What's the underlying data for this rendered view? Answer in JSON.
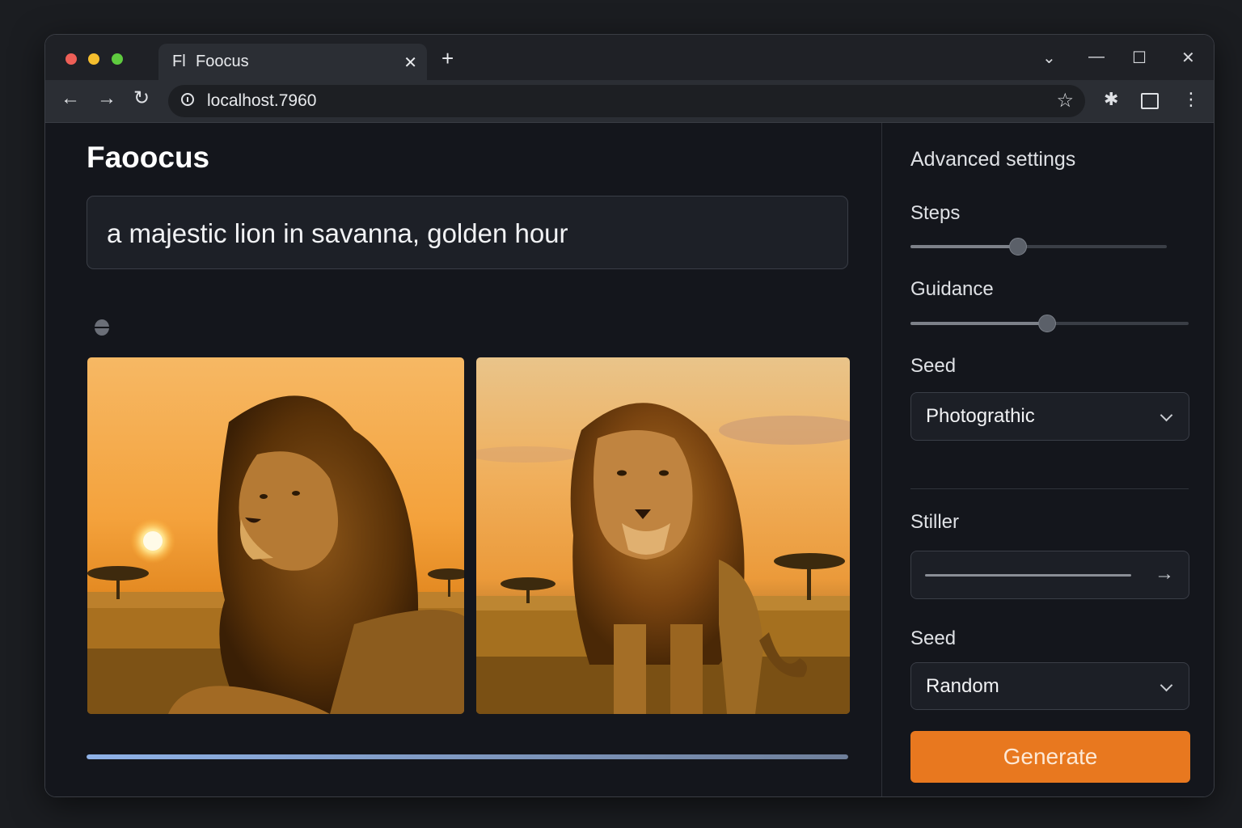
{
  "browser": {
    "tab": {
      "favicon_text": "Fl",
      "title": "Foocus",
      "close_glyph": "✕"
    },
    "new_tab_glyph": "+",
    "window_controls": [
      "⌄",
      "—",
      "☐",
      "✕"
    ],
    "nav": {
      "back_glyph": "←",
      "forward_glyph": "→",
      "reload_glyph": "↻"
    },
    "address": {
      "url": "localhost.7960",
      "bookmark_glyph": "☆"
    },
    "toolbar_icons": {
      "extensions_glyph": "✱",
      "menu_glyph": "⋮"
    }
  },
  "app": {
    "title": "Faoocus",
    "prompt": "a majestic lion in savanna, golden hour",
    "progress": 1.0,
    "images": [
      {
        "subject": "lion lying in savanna at sunset"
      },
      {
        "subject": "lion standing in savanna at sunset"
      }
    ]
  },
  "sidebar": {
    "title": "Advanced settings",
    "steps": {
      "label": "Steps",
      "value": 0.42
    },
    "guidance": {
      "label": "Guidance",
      "value": 0.49
    },
    "seed_style": {
      "label": "Seed",
      "value": "Photograthic"
    },
    "stiller": {
      "label": "Stiller",
      "arrow_glyph": "→"
    },
    "seed": {
      "label": "Seed",
      "value": "Random"
    },
    "generate_label": "Generate"
  },
  "colors": {
    "accent": "#e8781f",
    "background": "#14161c",
    "panel": "#1c1f26",
    "progress": "#8fb2e8"
  },
  "icons": [
    "info-icon",
    "star-icon",
    "extensions-icon",
    "chevron-down-icon",
    "arrow-right-icon",
    "spinner-icon"
  ]
}
